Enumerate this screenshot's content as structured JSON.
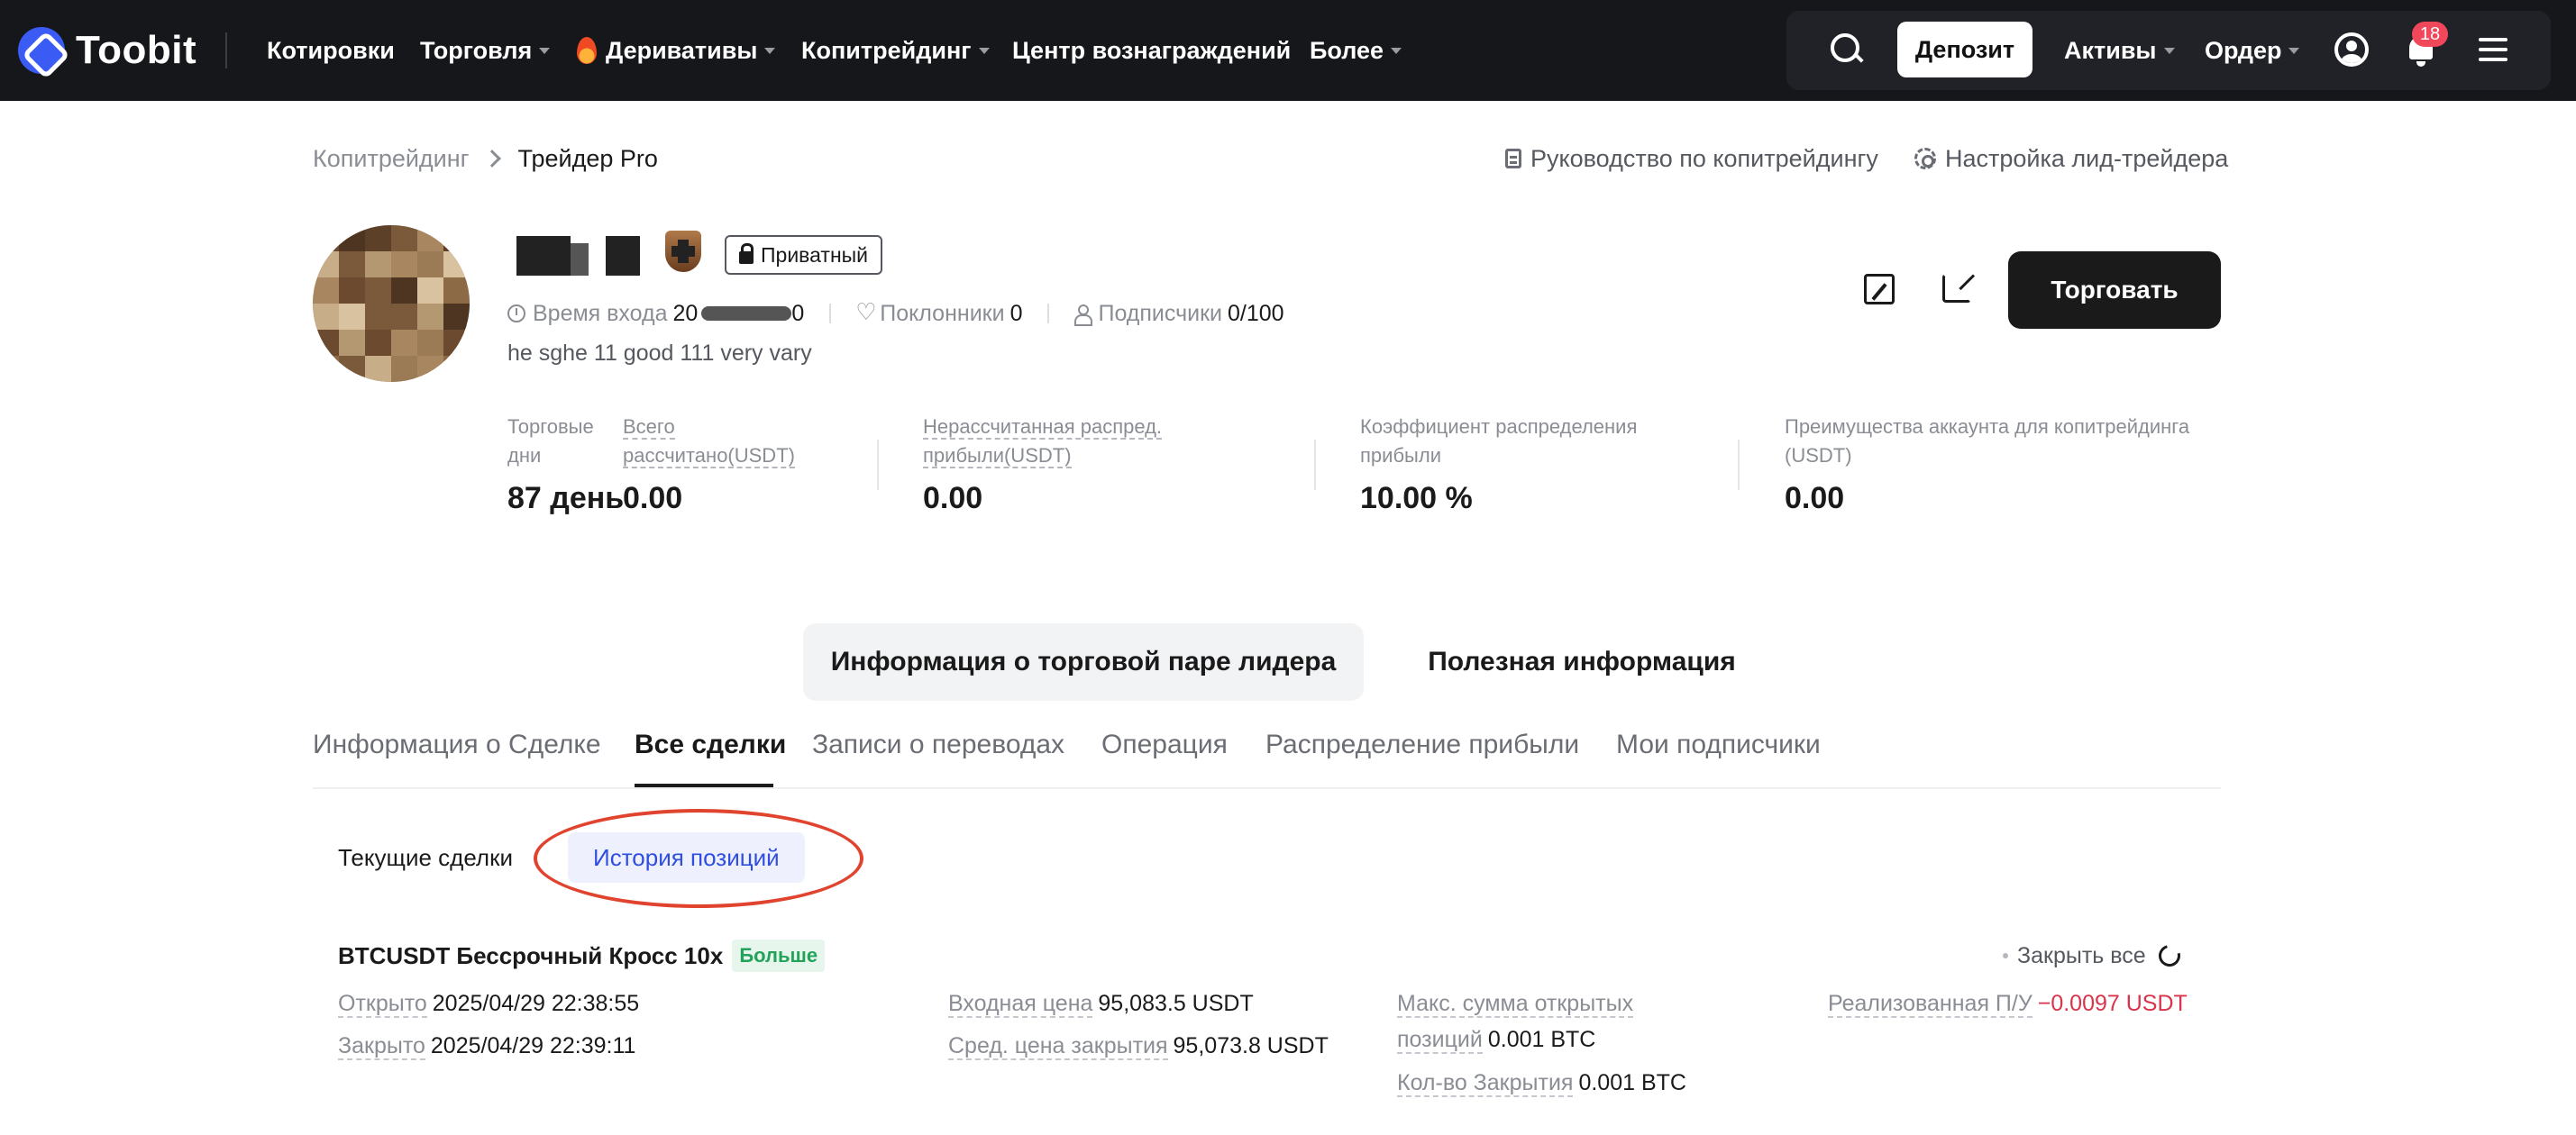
{
  "navbar": {
    "logo_text": "Toobit",
    "items": [
      {
        "label": "Котировки",
        "caret": false
      },
      {
        "label": "Торговля",
        "caret": true
      },
      {
        "label": "Деривативы",
        "caret": true
      },
      {
        "label": "Копитрейдинг",
        "caret": true
      },
      {
        "label": "Центр вознаграждений",
        "caret": false
      },
      {
        "label": "Более",
        "caret": true
      }
    ],
    "deposit_label": "Депозит",
    "assets_label": "Активы",
    "order_label": "Ордер",
    "notification_count": "18"
  },
  "breadcrumb": {
    "parent": "Копитрейдинг",
    "current": "Трейдер Pro"
  },
  "top_links": {
    "guide": "Руководство по копитрейдингу",
    "settings": "Настройка лид-трейдера"
  },
  "profile": {
    "private_label": "Приватный",
    "join_label": "Время входа",
    "join_value_visible": "20",
    "join_value_tail": "0",
    "fans_label": "Поклонники",
    "fans_value": "0",
    "subscribers_label": "Подписчики",
    "subscribers_value": "0/100",
    "bio": "he sghe 11 good 111 very vary",
    "trade_button": "Торговать"
  },
  "stats": [
    {
      "label": "Торговые дни",
      "value": "87 день",
      "dashed": false
    },
    {
      "label": "Всего рассчитано(USDT)",
      "value": "0.00",
      "dashed": true
    },
    {
      "label": "Нерассчитанная распред. прибыли(USDT)",
      "value": "0.00",
      "dashed": true
    },
    {
      "label": "Коэффициент распределения прибыли",
      "value": "10.00 %",
      "dashed": false
    },
    {
      "label": "Преимущества аккаунта для копитрейдинга (USDT)",
      "value": "0.00",
      "dashed": false
    }
  ],
  "segment_tabs": {
    "leader_pair_info": "Информация о торговой паре лидера",
    "useful_info": "Полезная информация"
  },
  "tabs": [
    {
      "label": "Информация о Сделке",
      "active": false
    },
    {
      "label": "Все сделки",
      "active": true
    },
    {
      "label": "Записи о переводах",
      "active": false
    },
    {
      "label": "Операция",
      "active": false
    },
    {
      "label": "Распределение прибыли",
      "active": false
    },
    {
      "label": "Мои подписчики",
      "active": false
    }
  ],
  "sub_tabs": {
    "current": "Текущие сделки",
    "history": "История позиций"
  },
  "position": {
    "title": "BTCUSDT Бессрочный Кросс 10x",
    "side_tag": "Больше",
    "close_all": "Закрыть все",
    "opened_label": "Открыто",
    "opened_value": "2025/04/29 22:38:55",
    "closed_label": "Закрыто",
    "closed_value": "2025/04/29 22:39:11",
    "entry_label": "Входная цена",
    "entry_value": "95,083.5 USDT",
    "avg_close_label": "Сред. цена закрытия",
    "avg_close_value": "95,073.8 USDT",
    "max_open_label_1": "Макс. сумма открытых",
    "max_open_label_2": "позиций",
    "max_open_value": "0.001 BTC",
    "closed_qty_label": "Кол-во Закрытия",
    "closed_qty_value": "0.001 BTC",
    "pnl_label": "Реализованная П/У",
    "pnl_value": "−0.0097 USDT"
  },
  "colors": {
    "navbar_bg": "#15171b",
    "accent_blue": "#2f4ee0",
    "buy_green": "#23a35a",
    "loss_red": "#d8344b",
    "annotation_red": "#e0432e"
  }
}
